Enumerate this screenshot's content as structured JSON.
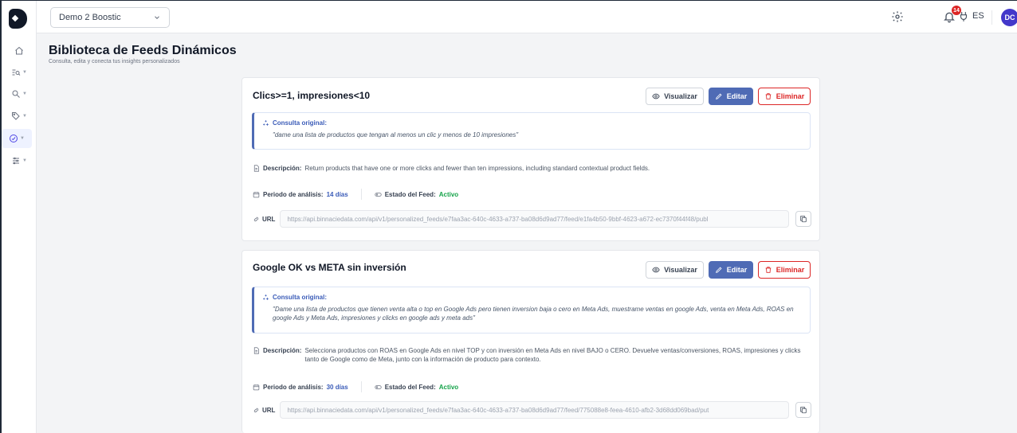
{
  "topbar": {
    "store_select": "Demo 2 Boostic",
    "notification_count": "14",
    "language": "ES",
    "avatar_initials": "DC"
  },
  "sidebar": {
    "items": [
      {
        "name": "home",
        "icon": "home-icon"
      },
      {
        "name": "reports",
        "icon": "list-search-icon"
      },
      {
        "name": "search",
        "icon": "search-icon"
      },
      {
        "name": "tags",
        "icon": "tag-icon"
      },
      {
        "name": "feeds",
        "icon": "gauge-icon",
        "active": true
      },
      {
        "name": "settings",
        "icon": "sliders-icon"
      }
    ]
  },
  "page": {
    "title": "Biblioteca de Feeds Dinámicos",
    "subtitle": "Consulta, edita y conecta tus insights personalizados"
  },
  "labels": {
    "view": "Visualizar",
    "edit": "Editar",
    "delete": "Eliminar",
    "original_query": "Consulta original:",
    "description": "Descripción:",
    "analysis_period": "Periodo de análisis:",
    "feed_status": "Estado del Feed:",
    "url": "URL"
  },
  "feeds": [
    {
      "title": "Clics>=1, impresiones<10",
      "query": "\"dame una lista de productos que tengan al menos un clic y menos de 10 impresiones\"",
      "description": "Return products that have one or more clicks and fewer than ten impressions, including standard contextual product fields.",
      "period": "14 días",
      "status": "Activo",
      "url": "https://api.binnaciedata.com/api/v1/personalized_feeds/e7faa3ac-640c-4633-a737-ba08d6d9ad77/feed/e1fa4b50-9bbf-4623-a672-ec7370f44f48/publ"
    },
    {
      "title": "Google OK vs META sin inversión",
      "query": "\"Dame una lista de productos que tienen venta alta o top en Google Ads pero tienen inversion baja o cero en Meta Ads, muestrame ventas en google Ads, venta en Meta Ads, ROAS en google Ads y Meta Ads, impresiones y clicks en google ads y meta ads\"",
      "description": "Selecciona productos con ROAS en Google Ads en nivel TOP y con inversión en Meta Ads en nivel BAJO o CERO. Devuelve ventas/conversiones, ROAS, impresiones y clicks tanto de Google como de Meta, junto con la información de producto para contexto.",
      "period": "30 días",
      "status": "Activo",
      "url": "https://api.binnaciedata.com/api/v1/personalized_feeds/e7faa3ac-640c-4633-a737-ba08d6d9ad77/feed/775088e8-feea-4610-afb2-3d68dd069bad/put"
    }
  ],
  "colors": {
    "accent": "#4f6bb5",
    "danger": "#dc2626",
    "success": "#16a34a"
  }
}
